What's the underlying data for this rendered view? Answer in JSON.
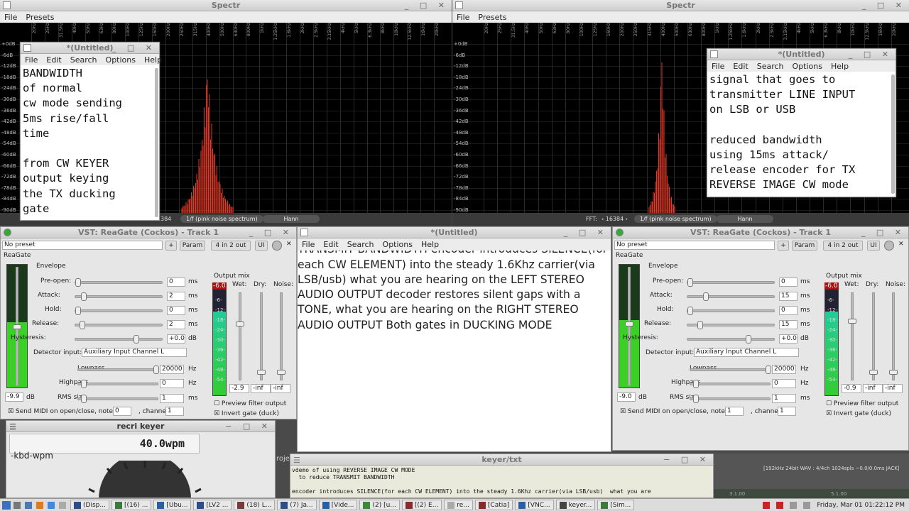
{
  "spectr_left": {
    "title": "Spectr",
    "menu": [
      "File",
      "Presets"
    ],
    "hz_labels": [
      "20Hz",
      "25Hz",
      "31.5Hz",
      "40Hz",
      "50Hz",
      "63Hz",
      "80Hz",
      "100Hz",
      "125Hz",
      "160Hz",
      "200Hz",
      "250Hz",
      "315Hz",
      "400Hz",
      "500Hz",
      "630Hz",
      "800Hz",
      "1kHz",
      "1.25kHz",
      "1.6kHz",
      "2kHz",
      "2.5kHz",
      "3.15kHz",
      "4kHz",
      "5kHz",
      "6.3kHz",
      "8kHz",
      "10kHz",
      "12.5kHz",
      "16kHz",
      "20kHz"
    ],
    "db_labels": [
      "+0dB",
      "-6dB",
      "-12dB",
      "-18dB",
      "-24dB",
      "-30dB",
      "-36dB",
      "-42dB",
      "-48dB",
      "-54dB",
      "-60dB",
      "-66dB",
      "-72dB",
      "-78dB",
      "-84dB",
      "-90dB"
    ],
    "fft_size": "16384",
    "fft_partial": "384",
    "weighting": "1/f (pink noise spectrum)",
    "window": "Hann"
  },
  "spectr_right": {
    "title": "Spectr",
    "menu": [
      "File",
      "Presets"
    ],
    "fft_label": "FFT:",
    "fft_size": "16384",
    "weighting": "1/f (pink noise spectrum)",
    "window": "Hann"
  },
  "note_left": {
    "title": "*(Untitled)",
    "menu": [
      "File",
      "Edit",
      "Search",
      "Options",
      "Help"
    ],
    "text": "BANDWIDTH\nof normal\ncw mode sending\n5ms rise/fall\ntime\n\nfrom CW KEYER\noutput keying\nthe TX ducking\ngate"
  },
  "note_right": {
    "title": "*(Untitled)",
    "menu": [
      "File",
      "Edit",
      "Search",
      "Options",
      "Help"
    ],
    "text": "signal that goes to\ntransmitter LINE INPUT\non LSB or USB\n\nreduced bandwidth\nusing 15ms attack/\nrelease encoder for TX\nREVERSE IMAGE CW mode"
  },
  "note_center": {
    "title": "*(Untitled)",
    "menu": [
      "File",
      "Edit",
      "Search",
      "Options",
      "Help"
    ],
    "text": "demo of using REVERSE IMAGE CW MODE\n  to reduce TRANSMIT BANDWIDTH\n\nencoder introduces SILENCE(for each CW\nELEMENT) into the steady 1.6Khz\ncarrier(via LSB/usb)  what you are\nhearing on the LEFT STEREO AUDIO OUTPUT\n\ndecoder restores silent gaps with a\nTONE, what you are hearing on the RIGHT\nSTEREO AUDIO OUTPUT\n\nBoth gates in  DUCKING MODE"
  },
  "vst_left": {
    "title": "VST: ReaGate (Cockos) - Track 1",
    "preset": "No preset",
    "plus": "+",
    "param": "Param",
    "io": "4 in 2 out",
    "ui": "UI",
    "plugin": "ReaGate",
    "envelope": "Envelope",
    "preopen_label": "Pre-open:",
    "preopen": "0",
    "attack_label": "Attack:",
    "attack": "2",
    "hold_label": "Hold:",
    "hold": "0",
    "release_label": "Release:",
    "release": "2",
    "hyst_label": "Hysteresis:",
    "hyst": "+0.0",
    "ms": "ms",
    "db": "dB",
    "hz": "Hz",
    "detector_label": "Detector input:",
    "detector": "Auxiliary Input Channel L",
    "lowpass_label": "Lowpass",
    "lowpass": "20000",
    "highpass_label": "Highpass",
    "highpass": "0",
    "rms_label": "RMS size",
    "rms": "1",
    "thresh": "-9.9",
    "output_mix": "Output mix",
    "wet": "Wet:",
    "dry": "Dry:",
    "noise": "Noise:",
    "peak": "-6.0",
    "wet_val": "-2.9",
    "dry_val": "-inf",
    "noise_val": "-inf",
    "preview": "Preview filter output",
    "invert": "Invert gate (duck)",
    "midi": "Send MIDI on open/close, note:",
    "midi_note": "0",
    "channel_label": ", channel:",
    "channel": "1",
    "meter_marks": [
      "-6-",
      "-12-",
      "-18-",
      "-24-",
      "-30-",
      "-36-",
      "-42-",
      "-48-",
      "-54-"
    ]
  },
  "vst_right": {
    "title": "VST: ReaGate (Cockos) - Track 1",
    "preset": "No preset",
    "plus": "+",
    "param": "Param",
    "io": "4 in 2 out",
    "ui": "UI",
    "plugin": "ReaGate",
    "envelope": "Envelope",
    "preopen_label": "Pre-open:",
    "preopen": "0",
    "attack_label": "Attack:",
    "attack": "15",
    "hold_label": "Hold:",
    "hold": "0",
    "release_label": "Release:",
    "release": "15",
    "hyst_label": "Hysteresis:",
    "hyst": "+0.0",
    "ms": "ms",
    "db": "dB",
    "hz": "Hz",
    "detector_label": "Detector input:",
    "detector": "Auxiliary Input Channel L",
    "lowpass_label": "Lowpass",
    "lowpass": "20000",
    "highpass_label": "Highpass",
    "highpass": "0",
    "rms_label": "RMS size",
    "rms": "1",
    "thresh": "-9.0",
    "output_mix": "Output mix",
    "wet": "Wet:",
    "dry": "Dry:",
    "noise": "Noise:",
    "peak": "-6.0",
    "wet_val": "-0.9",
    "dry_val": "-inf",
    "noise_val": "-inf",
    "preview": "Preview filter output",
    "invert": "Invert gate (duck)",
    "midi": "Send MIDI on open/close, note:",
    "midi_note": "1",
    "channel_label": ", channel:",
    "channel": "1",
    "meter_marks": [
      "-6-",
      "-12-",
      "-18-",
      "-24-",
      "-30-",
      "-36-",
      "-42-",
      "-48-",
      "-54-"
    ]
  },
  "keyer": {
    "title": "recri keyer",
    "wpm": "40.0wpm",
    "mode": "-kbd-wpm"
  },
  "keyer_txt": {
    "title": "keyer/txt",
    "text": "vdemo of using REVERSE IMAGE CW MODE\n  to reduce TRANSMIT BANDWIDTH\n\nencoder introduces SILENCE(for each CW ELEMENT) into the steady 1.6Khz carrier(via LSB/usb)  what you are"
  },
  "reaper": {
    "status": "[192kHz 24bit WAV : 4/4ch 1024spls ~0.0/0.0ms JACK]",
    "t1": "3.1.00",
    "t2": "5.1.00",
    "proj": "roje"
  },
  "taskbar": {
    "items": [
      "(Disp...",
      "[(16) ...",
      "[Ubu...",
      "[LV2 ...",
      "(18) L...",
      "(7) Ja...",
      "[Vide...",
      "(2) [u...",
      "[(2) E...",
      "re...",
      "[Catia]",
      "[VNC...",
      "keyer...",
      "[Sim..."
    ],
    "clock": "Friday, Mar 01 01:22:12 PM"
  }
}
